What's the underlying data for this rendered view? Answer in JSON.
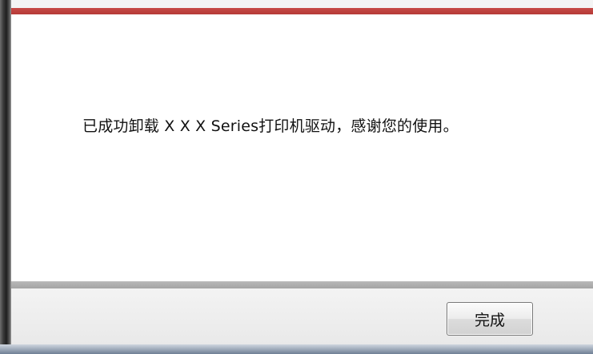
{
  "dialog": {
    "message": "已成功卸载 X X X  Series打印机驱动，感谢您的使用。",
    "finish_button_label": "完成"
  },
  "colors": {
    "accent_bar": "#b53a37",
    "separator": "#a9a9a9",
    "footer_bg": "#efefef"
  }
}
